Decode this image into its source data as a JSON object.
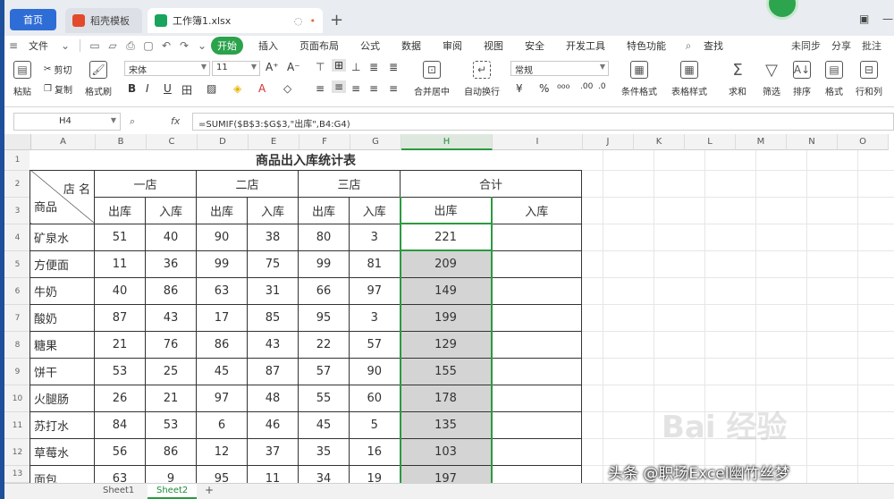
{
  "tabs": {
    "home": "首页",
    "doc1": "稻壳模板",
    "doc2": "工作簿1.xlsx",
    "add": "+"
  },
  "menu": {
    "file": "文件",
    "items": [
      "开始",
      "插入",
      "页面布局",
      "公式",
      "数据",
      "审阅",
      "视图",
      "安全",
      "开发工具",
      "特色功能"
    ],
    "active_index": 0,
    "search": "查找",
    "right": [
      "未同步",
      "分享",
      "批注"
    ]
  },
  "ribbon": {
    "paste": "粘贴",
    "cut": "剪切",
    "copy": "复制",
    "format_painter": "格式刷",
    "font_name": "宋体",
    "font_size": "11",
    "merge_center": "合并居中",
    "wrap": "自动换行",
    "number_format": "常规",
    "cond_format": "条件格式",
    "table_style": "表格样式",
    "sum": "求和",
    "filter": "筛选",
    "sort": "排序",
    "fill": "格式",
    "row_col": "行和列"
  },
  "formula_bar": {
    "cell_ref": "H4",
    "fx": "fx",
    "formula": "=SUMIF($B$3:$G$3,\"出库\",B4:G4)"
  },
  "columns": [
    "A",
    "B",
    "C",
    "D",
    "E",
    "F",
    "G",
    "H",
    "I",
    "J",
    "K",
    "L",
    "M",
    "N",
    "O"
  ],
  "rows": [
    "1",
    "2",
    "3",
    "4",
    "5",
    "6",
    "7",
    "8",
    "9",
    "10",
    "11",
    "12",
    "13"
  ],
  "sheet": {
    "title": "商品出入库统计表",
    "diag_top": "店 名",
    "diag_bottom": "商品",
    "stores": [
      "一店",
      "二店",
      "三店",
      "合计"
    ],
    "sub": [
      "出库",
      "入库"
    ],
    "data": [
      {
        "name": "矿泉水",
        "v": [
          "51",
          "40",
          "90",
          "38",
          "80",
          "3"
        ],
        "out": "221",
        "in": ""
      },
      {
        "name": "方便面",
        "v": [
          "11",
          "36",
          "99",
          "75",
          "99",
          "81"
        ],
        "out": "209",
        "in": ""
      },
      {
        "name": "牛奶",
        "v": [
          "40",
          "86",
          "63",
          "31",
          "66",
          "97"
        ],
        "out": "149",
        "in": ""
      },
      {
        "name": "酸奶",
        "v": [
          "87",
          "43",
          "17",
          "85",
          "95",
          "3"
        ],
        "out": "199",
        "in": ""
      },
      {
        "name": "糖果",
        "v": [
          "21",
          "76",
          "86",
          "43",
          "22",
          "57"
        ],
        "out": "129",
        "in": ""
      },
      {
        "name": "饼干",
        "v": [
          "53",
          "25",
          "45",
          "87",
          "57",
          "90"
        ],
        "out": "155",
        "in": ""
      },
      {
        "name": "火腿肠",
        "v": [
          "26",
          "21",
          "97",
          "48",
          "55",
          "60"
        ],
        "out": "178",
        "in": ""
      },
      {
        "name": "苏打水",
        "v": [
          "84",
          "53",
          "6",
          "46",
          "45",
          "5"
        ],
        "out": "135",
        "in": ""
      },
      {
        "name": "草莓水",
        "v": [
          "56",
          "86",
          "12",
          "37",
          "35",
          "16"
        ],
        "out": "103",
        "in": ""
      },
      {
        "name": "面包",
        "v": [
          "63",
          "9",
          "95",
          "11",
          "34",
          "19"
        ],
        "out": "197",
        "in": ""
      }
    ]
  },
  "sheets": [
    "Sheet1",
    "Sheet2"
  ],
  "active_sheet": 1,
  "watermark": "头条 @职场Excel幽竹丝梦",
  "watermark_logo": "Bai 经验",
  "colors": {
    "accent": "#2ba24c",
    "home_tab": "#2f6dd6"
  }
}
